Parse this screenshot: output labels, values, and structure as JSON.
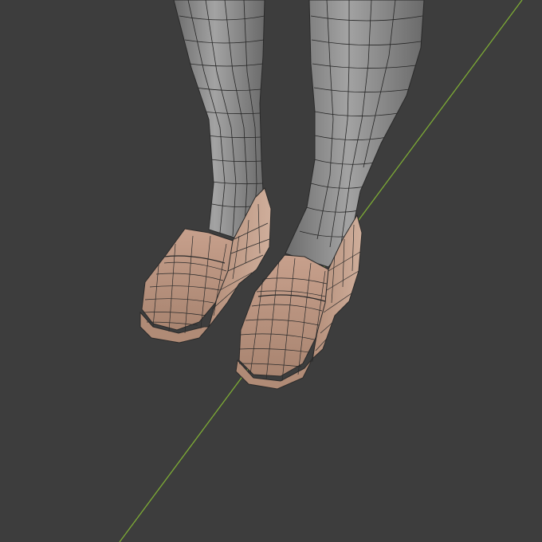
{
  "viewport": {
    "background_color": "#3d3d3d",
    "wire_color": "#1f1f1f",
    "axis": {
      "name": "y-axis",
      "color": "#7dab35"
    },
    "object": {
      "name": "legs-with-loafers",
      "mesh_color": "#8f8f8f",
      "mesh_highlight": "#b4b4b4",
      "shoe_color": "#c9a38f",
      "shoe_shadow": "#9f7b67"
    }
  }
}
